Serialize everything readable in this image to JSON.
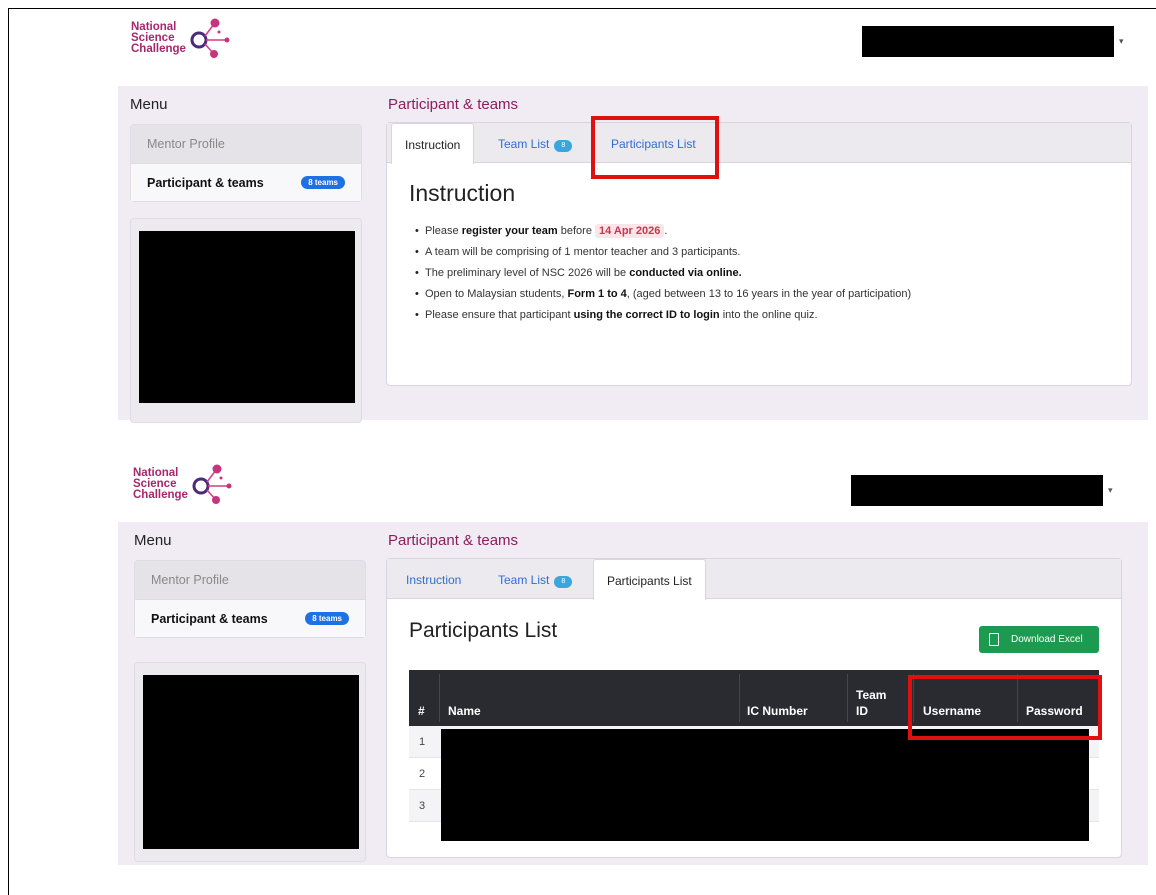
{
  "logo": {
    "line1": "National",
    "line2": "Science",
    "line3": "Challenge"
  },
  "menu": {
    "title": "Menu",
    "items": [
      {
        "label": "Mentor Profile"
      },
      {
        "label": "Participant & teams",
        "badge": "8 teams"
      }
    ]
  },
  "section_title": "Participant & teams",
  "tabs": [
    {
      "label": "Instruction"
    },
    {
      "label": "Team List",
      "count": "8"
    },
    {
      "label": "Participants List"
    }
  ],
  "instruction": {
    "heading": "Instruction",
    "items": [
      {
        "pre": "Please ",
        "bold": "register your team",
        "mid": " before ",
        "date": "14 Apr 2026",
        "post": "."
      },
      {
        "text": "A team will be comprising of 1 mentor teacher and 3 participants."
      },
      {
        "pre": "The preliminary level of NSC 2026 will be ",
        "bold": "conducted via online.",
        "post": ""
      },
      {
        "pre": "Open to Malaysian students, ",
        "bold": "Form 1 to 4",
        "post": ", (aged between 13 to 16 years in the year of participation)"
      },
      {
        "pre": "Please ensure that participant ",
        "bold": "using the correct ID to login",
        "post": " into the online quiz."
      }
    ]
  },
  "participants": {
    "heading": "Participants List",
    "download_label": "Download Excel",
    "columns": [
      {
        "line1": "#"
      },
      {
        "line1": "Name"
      },
      {
        "line1": "IC Number"
      },
      {
        "line1": "Team",
        "line2": "ID"
      },
      {
        "line1": "Username"
      },
      {
        "line1": "Password"
      }
    ],
    "rows": [
      "1",
      "2",
      "3"
    ]
  },
  "colors": {
    "brand": "#a3286b",
    "section_title": "#8b1e5c",
    "highlight_box": "#e01010",
    "download": "#1c9a50"
  },
  "icons": [
    "download-excel-icon",
    "nsc-molecule-logo-icon",
    "caret-down-icon"
  ]
}
